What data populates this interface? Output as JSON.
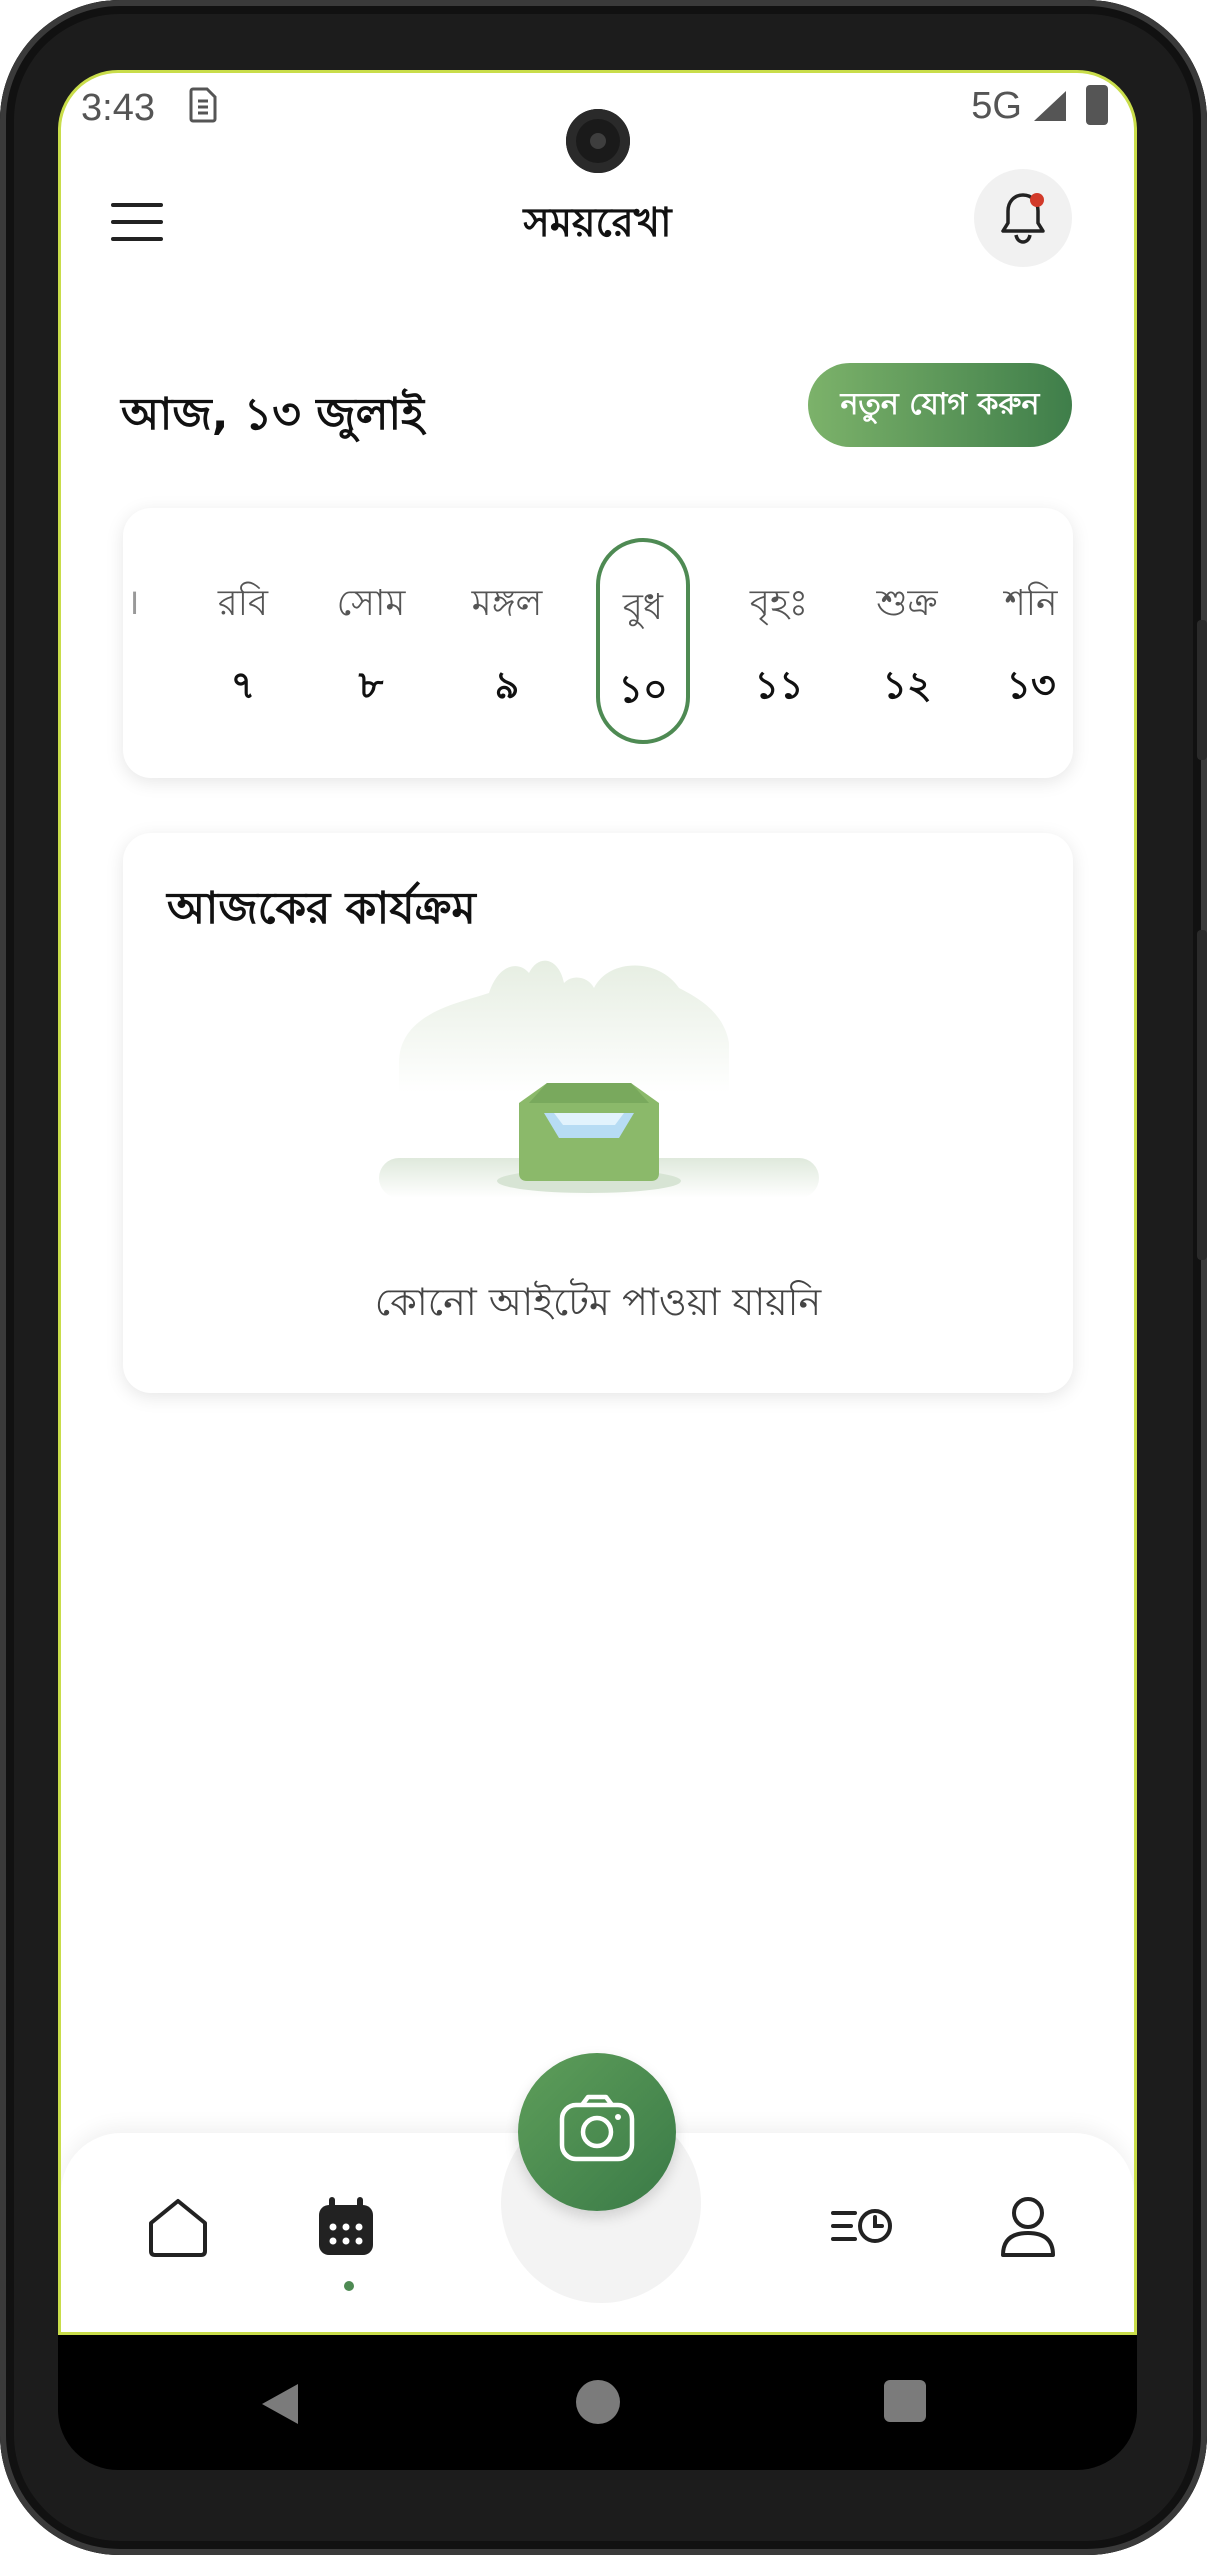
{
  "status_bar": {
    "time": "3:43",
    "sim_icon": "sim-card-icon",
    "network": "5G",
    "signal_icon": "signal-icon",
    "battery_icon": "battery-icon"
  },
  "header": {
    "title": "সময়রেখা",
    "menu_icon": "hamburger-menu-icon",
    "notification_icon": "bell-icon"
  },
  "date_row": {
    "today_label": "আজ, ১৩ জুলাই",
    "add_button_label": "নতুন যোগ করুন"
  },
  "week": {
    "days": [
      {
        "name": "রবি",
        "num": "৭"
      },
      {
        "name": "সোম",
        "num": "৮"
      },
      {
        "name": "মঙ্গল",
        "num": "৯"
      },
      {
        "name": "বুধ",
        "num": "১০",
        "selected": true
      },
      {
        "name": "বৃহঃ",
        "num": "১১"
      },
      {
        "name": "শুক্র",
        "num": "১২"
      },
      {
        "name": "শনি",
        "num": "১৩"
      }
    ]
  },
  "activities": {
    "title": "আজকের কার্যক্রম",
    "empty_text": "কোনো আইটেম পাওয়া যায়নি",
    "illustration_icon": "empty-inbox-icon"
  },
  "bottom_nav": {
    "items": [
      "home-icon",
      "calendar-icon",
      "camera-icon",
      "schedule-list-icon",
      "profile-icon"
    ],
    "active": "calendar-icon"
  },
  "colors": {
    "accent": "#4e8a53",
    "accent_light": "#7cb26a",
    "notification_dot": "#d23a2a",
    "screen_border": "#c9dd4a"
  }
}
